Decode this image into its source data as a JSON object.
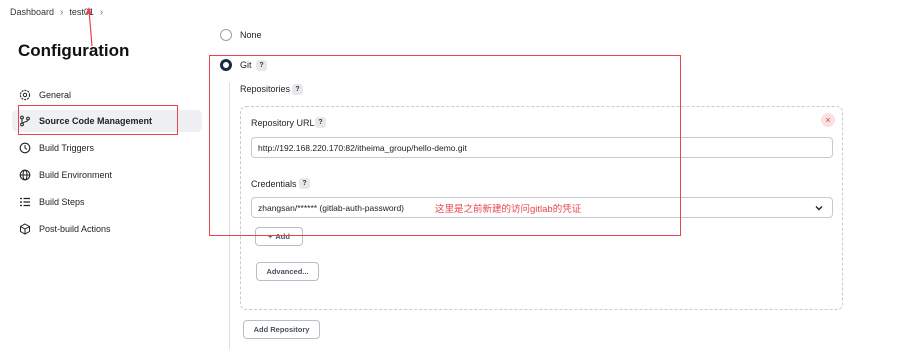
{
  "breadcrumb": {
    "items": [
      "Dashboard",
      "test01"
    ]
  },
  "page": {
    "title": "Configuration"
  },
  "sidebar": {
    "items": [
      {
        "label": "General",
        "icon": "gear-icon",
        "active": false
      },
      {
        "label": "Source Code Management",
        "icon": "branch-icon",
        "active": true
      },
      {
        "label": "Build Triggers",
        "icon": "clock-icon",
        "active": false
      },
      {
        "label": "Build Environment",
        "icon": "globe-icon",
        "active": false
      },
      {
        "label": "Build Steps",
        "icon": "list-icon",
        "active": false
      },
      {
        "label": "Post-build Actions",
        "icon": "cube-icon",
        "active": false
      }
    ]
  },
  "scm": {
    "none_label": "None",
    "git_label": "Git",
    "selected": "Git",
    "help_label": "?",
    "repositories_label": "Repositories",
    "repository_url_label": "Repository URL",
    "repository_url_value": "http://192.168.220.170:82/itheima_group/hello-demo.git",
    "credentials_label": "Credentials",
    "credentials_value": "zhangsan/****** (gitlab-auth-password)",
    "add_label": "Add",
    "advanced_label": "Advanced...",
    "add_repository_label": "Add Repository",
    "remove_label": "×"
  },
  "annotation": {
    "text": "这里是之前新建的访问gitlab的凭证",
    "color": "#e8454f"
  },
  "colors": {
    "accent": "#1b2a44",
    "annotation": "#e8454f",
    "active_bg": "#eef0f4"
  }
}
